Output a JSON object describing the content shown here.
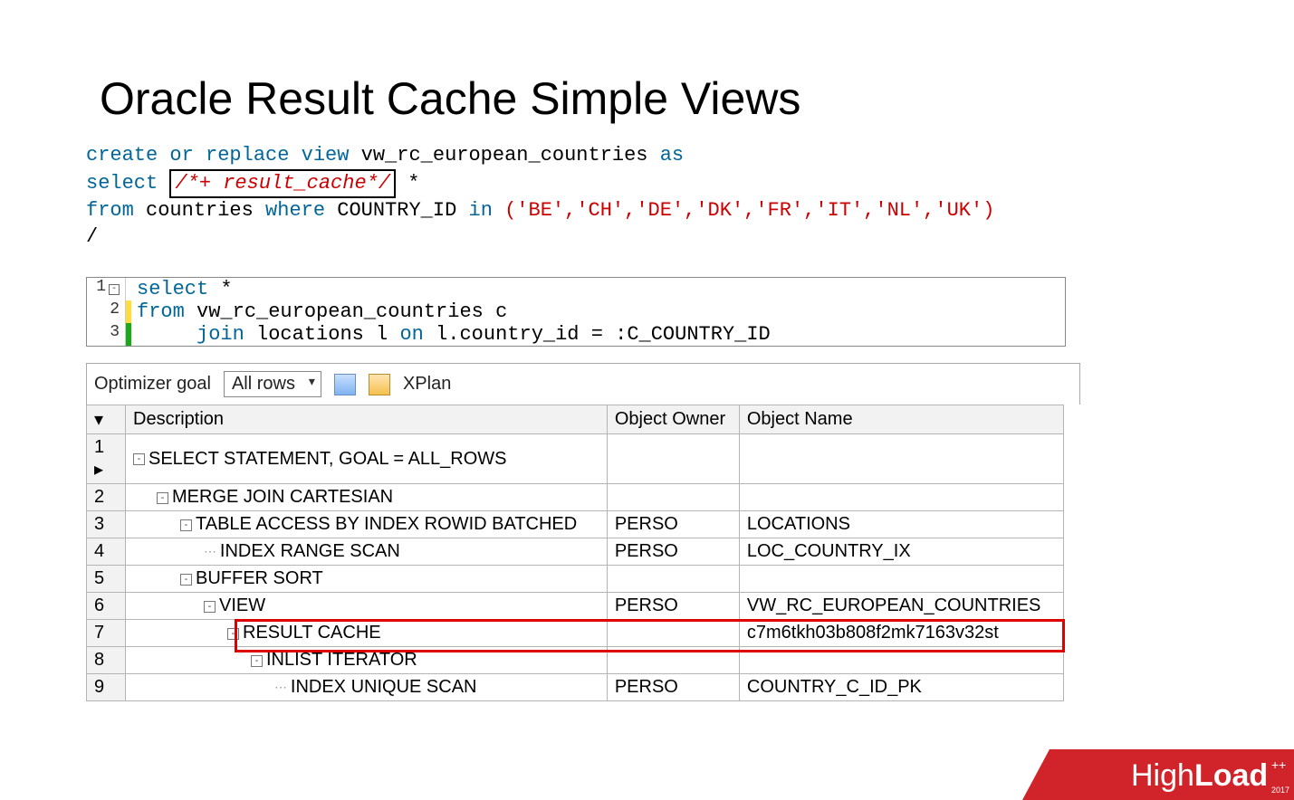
{
  "title": "Oracle Result Cache Simple Views",
  "sql1": {
    "line1_pre": "create or replace view",
    "line1_view": "vw_rc_european_countries",
    "line1_post": "as",
    "line2_select": "select",
    "line2_hint": "/*+ result_cache*/",
    "line2_star": "*",
    "line3_pre": "from",
    "line3_tbl": "countries",
    "line3_where": "where",
    "line3_col": "COUNTRY_ID",
    "line3_in": "in",
    "line3_list": "('BE','CH','DE','DK','FR','IT','NL','UK')",
    "line4": "/"
  },
  "sql2": {
    "rows": [
      {
        "n": "1",
        "change": "",
        "code_pre": "select",
        "code_post": " *"
      },
      {
        "n": "2",
        "change": "yellow",
        "code_pre": "from ",
        "code_id": "vw_rc_european_countries c"
      },
      {
        "n": "3",
        "change": "green",
        "code_pad": "     ",
        "code_pre": "join ",
        "code_id": "locations l ",
        "code_on": "on ",
        "code_expr": "l.country_id = :C_COUNTRY_ID"
      }
    ]
  },
  "toolbar": {
    "label": "Optimizer goal",
    "combo": "All rows",
    "xplan": "XPlan"
  },
  "plan": {
    "headers": [
      "Description",
      "Object Owner",
      "Object Name"
    ],
    "rows": [
      {
        "n": "1",
        "indent": 0,
        "toggle": "-",
        "desc": "SELECT STATEMENT, GOAL = ALL_ROWS",
        "owner": "",
        "obj": ""
      },
      {
        "n": "2",
        "indent": 1,
        "toggle": "-",
        "desc": "MERGE JOIN CARTESIAN",
        "owner": "",
        "obj": ""
      },
      {
        "n": "3",
        "indent": 2,
        "toggle": "-",
        "desc": "TABLE ACCESS BY INDEX ROWID BATCHED",
        "owner": "PERSO",
        "obj": "LOCATIONS"
      },
      {
        "n": "4",
        "indent": 3,
        "toggle": "",
        "desc": "INDEX RANGE SCAN",
        "owner": "PERSO",
        "obj": "LOC_COUNTRY_IX"
      },
      {
        "n": "5",
        "indent": 2,
        "toggle": "-",
        "desc": "BUFFER SORT",
        "owner": "",
        "obj": ""
      },
      {
        "n": "6",
        "indent": 3,
        "toggle": "-",
        "desc": "VIEW",
        "owner": "PERSO",
        "obj": "VW_RC_EUROPEAN_COUNTRIES"
      },
      {
        "n": "7",
        "indent": 4,
        "toggle": "-",
        "desc": "RESULT CACHE",
        "owner": "",
        "obj": "c7m6tkh03b808f2mk7163v32st"
      },
      {
        "n": "8",
        "indent": 5,
        "toggle": "-",
        "desc": "INLIST ITERATOR",
        "owner": "",
        "obj": ""
      },
      {
        "n": "9",
        "indent": 6,
        "toggle": "",
        "desc": "INDEX UNIQUE SCAN",
        "owner": "PERSO",
        "obj": "COUNTRY_C_ID_PK"
      }
    ]
  },
  "logo": {
    "brand_pre": "High",
    "brand_bold": "Load",
    "suffix": "++",
    "year": "2017"
  }
}
